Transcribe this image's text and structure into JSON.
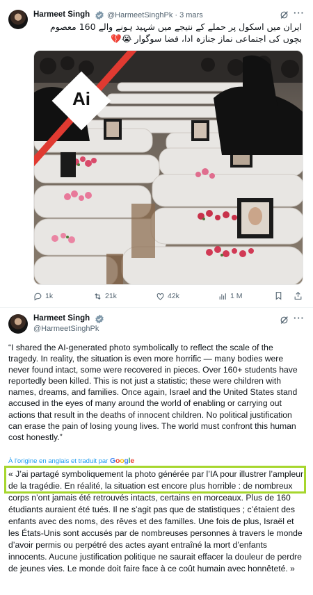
{
  "tweet1": {
    "name": "Harmeet Singh",
    "handle_date": "@HarmeetSinghPk · 3 mars",
    "text": "ایران میں اسکول پر حملے کے نتیجے میں شہید ہونے والے 160 معصوم بچوں کی اجتماعی نماز جنازہ ادا، فضا سوگوار 😭💔",
    "image_badge": "Ai",
    "actions": {
      "replies": "1k",
      "retweets": "21k",
      "likes": "42k",
      "views": "1 M"
    }
  },
  "tweet2": {
    "name": "Harmeet Singh",
    "handle": "@HarmeetSinghPk",
    "quote_en": "“I shared the AI-generated photo symbolically to reflect the scale of the tragedy. In reality, the situation is even more horrific — many bodies were never found intact, some were recovered in pieces. Over 160+ students have reportedly been killed. This is not just a statistic; these were children with names, dreams, and families. Once again, Israel and the United States stand accused in the eyes of many around the world of enabling or carrying out actions that result in the deaths of innocent children. No political justification can erase the pain of losing young lives. The world must confront this human cost honestly.”",
    "translated_label": "À l'origine en anglais et traduit par",
    "google_brand": "Google",
    "quote_fr": "« J’ai partagé symboliquement la photo générée par l’IA pour illustrer l’ampleur de la tragédie. En réalité, la situation est encore plus horrible : de nombreux corps n’ont jamais été retrouvés intacts, certains en morceaux. Plus de 160 étudiants auraient été tués. Il ne s’agit pas que de statistiques ; c’étaient des enfants avec des noms, des rêves et des familles. Une fois de plus, Israël et les États-Unis sont accusés par de nombreuses personnes à travers le monde d’avoir permis ou perpétré des actes ayant entraîné la mort d’enfants innocents. Aucune justification politique ne saurait effacer la douleur de perdre de jeunes vies. Le monde doit faire face à ce coût humain avec honnêteté. »"
  },
  "colors": {
    "highlight": "#a6d62d",
    "link": "#1d9bf0",
    "verified": "#829aab",
    "ai_banner": "#e03a31"
  }
}
